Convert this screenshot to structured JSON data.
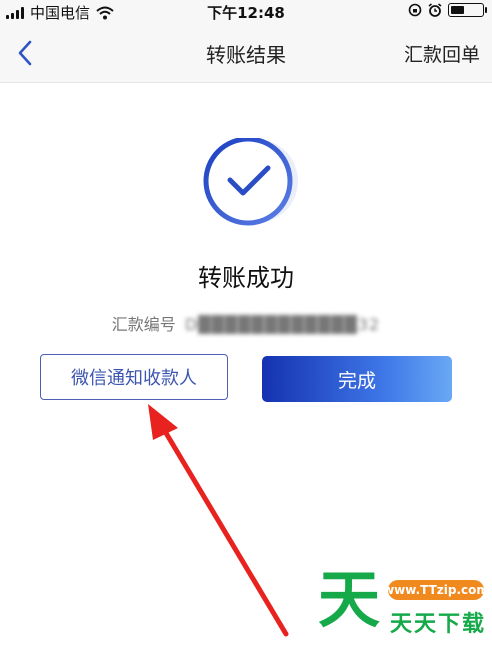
{
  "status_bar": {
    "carrier": "中国电信",
    "time": "下午12:48",
    "battery_level": 0.45
  },
  "nav": {
    "back_icon": "chevron-left-icon",
    "title": "转账结果",
    "right_action": "汇款回单"
  },
  "result": {
    "icon": "check-circle-icon",
    "title": "转账成功",
    "serial_label": "汇款编号",
    "serial_value": "D████████████32"
  },
  "actions": {
    "notify_label": "微信通知收款人",
    "done_label": "完成"
  },
  "annotation": {
    "arrow_color": "#e8231f"
  },
  "watermark": {
    "big_char": "天",
    "url": "www.TTzip.com",
    "text": "天天下载"
  },
  "colors": {
    "accent_blue": "#2142b8",
    "watermark_green": "#16a94a",
    "watermark_orange": "#f08a1f"
  }
}
